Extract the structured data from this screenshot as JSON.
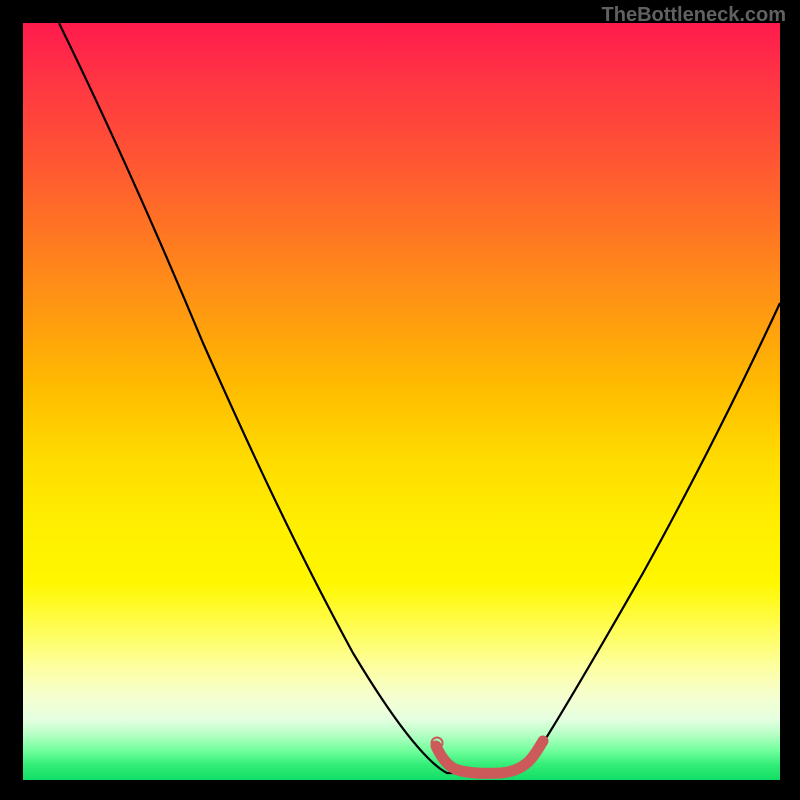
{
  "watermark": "TheBottleneck.com",
  "chart_data": {
    "type": "line",
    "title": "",
    "xlabel": "",
    "ylabel": "",
    "x_range": [
      0,
      100
    ],
    "y_range": [
      0,
      100
    ],
    "series": [
      {
        "name": "bottleneck-curve",
        "style": "thin-black",
        "x": [
          5,
          10,
          15,
          20,
          25,
          30,
          35,
          40,
          45,
          50,
          53,
          56,
          60,
          64,
          67,
          70,
          75,
          80,
          85,
          90,
          95,
          100
        ],
        "y": [
          100,
          90,
          80,
          70,
          60,
          51,
          42,
          33,
          24,
          14,
          7,
          3,
          1,
          1,
          3,
          8,
          17,
          27,
          37,
          47,
          57,
          67
        ]
      },
      {
        "name": "optimal-zone",
        "style": "thick-red",
        "x": [
          54.5,
          55.5,
          57,
          59,
          61,
          63,
          65,
          66.5,
          68
        ],
        "y": [
          4.5,
          2.5,
          1.3,
          0.8,
          0.8,
          0.8,
          1.3,
          2.5,
          4.2
        ]
      }
    ],
    "background_gradient": {
      "type": "vertical",
      "stops": [
        {
          "pos": 0,
          "color": "#ff1a4d",
          "meaning": "high-bottleneck"
        },
        {
          "pos": 50,
          "color": "#ffdd00",
          "meaning": "moderate"
        },
        {
          "pos": 100,
          "color": "#11dd66",
          "meaning": "no-bottleneck"
        }
      ]
    }
  }
}
